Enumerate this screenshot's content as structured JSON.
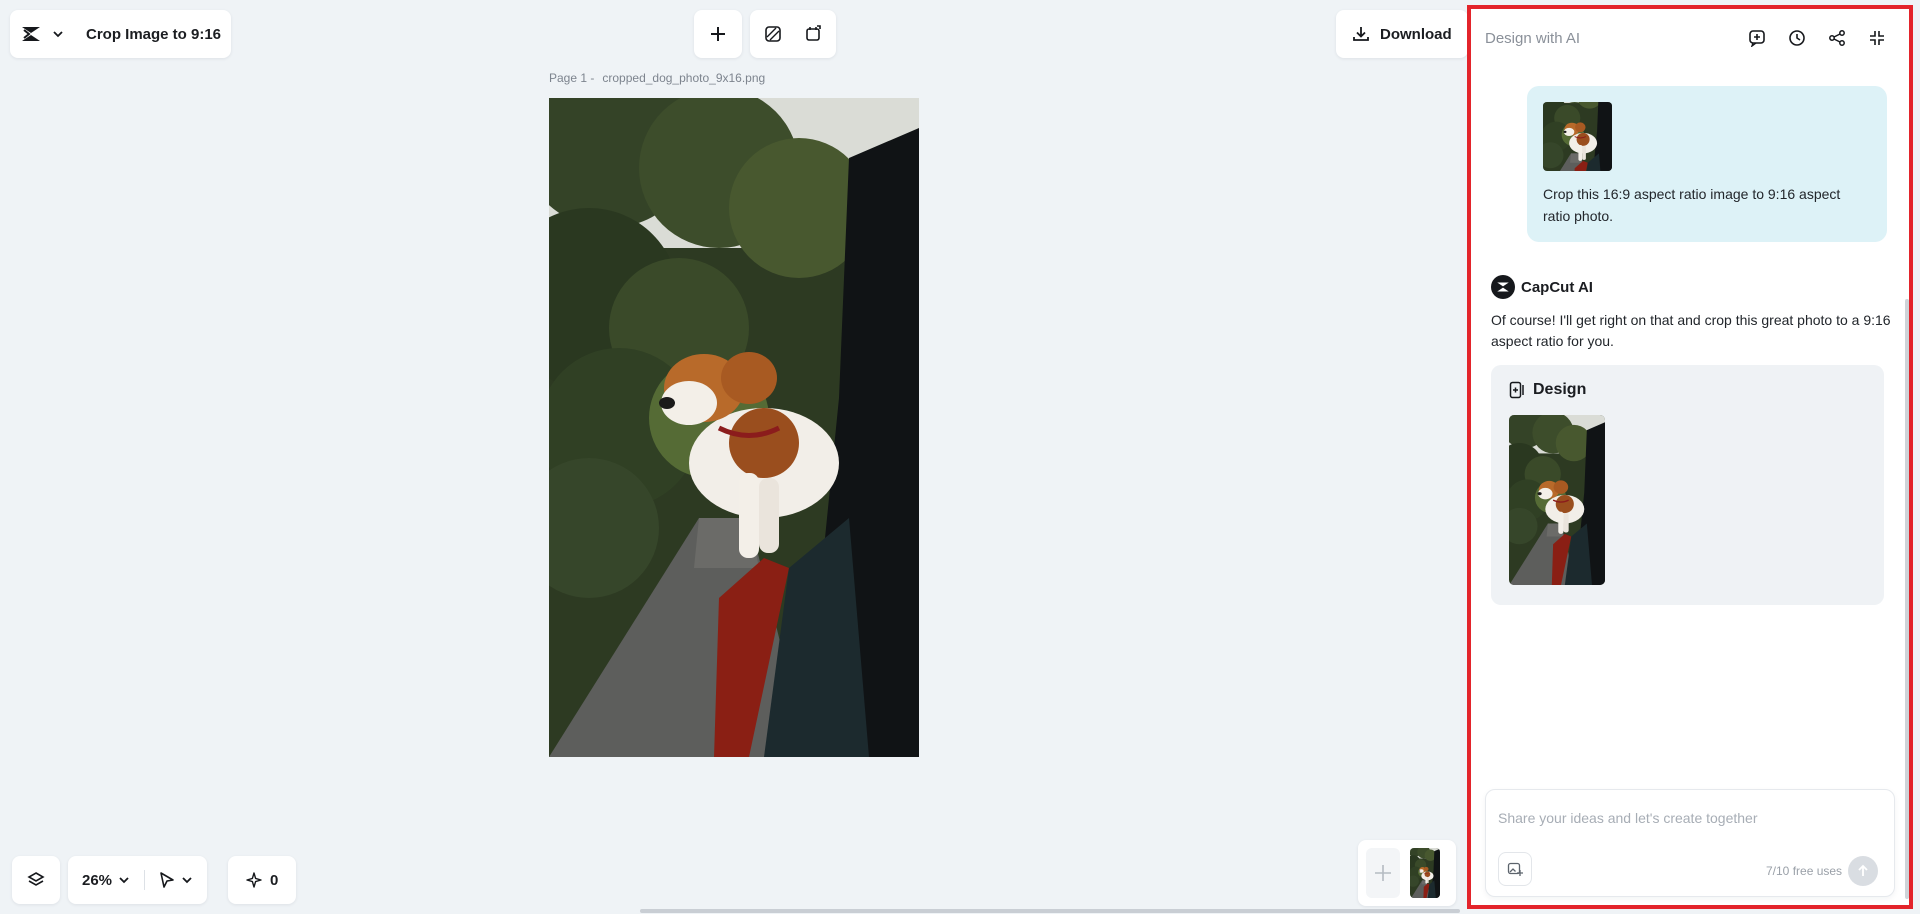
{
  "app": {
    "document_title": "Crop Image to 9:16",
    "download_label": "Download"
  },
  "canvas": {
    "page_label": "Page 1 -",
    "file_name": "cropped_dog_photo_9x16.png"
  },
  "bottom_bar": {
    "zoom": "26%",
    "credits": "0"
  },
  "ai_panel": {
    "title": "Design with AI",
    "user_message": "Crop this 16:9 aspect ratio image to 9:16 aspect ratio photo.",
    "assistant_name": "CapCut AI",
    "assistant_message": "Of course! I'll get right on that and crop this great photo to a 9:16 aspect ratio for you.",
    "design_card_title": "Design",
    "composer": {
      "placeholder": "Share your ideas and let's create together",
      "value": "",
      "usage": "7/10 free uses"
    }
  },
  "colors": {
    "background": "#eff3f6",
    "panel_highlight": "#e3242b",
    "user_bubble": "#ddf2f7"
  },
  "icons": [
    "capcut-logo-icon",
    "chevron-down-icon",
    "plus-icon",
    "background-remove-icon",
    "resize-icon",
    "download-icon",
    "new-chat-icon",
    "history-icon",
    "share-icon",
    "collapse-icon",
    "layers-icon",
    "pointer-icon",
    "sparkle-icon",
    "design-icon",
    "image-attach-icon",
    "send-arrow-icon"
  ]
}
